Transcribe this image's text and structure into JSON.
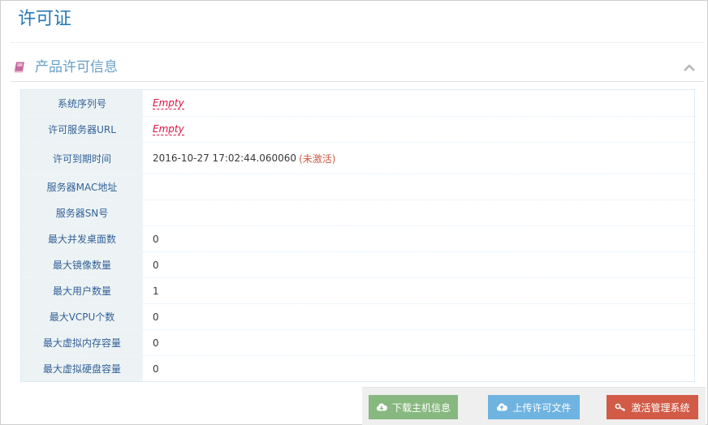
{
  "page": {
    "title": "许可证"
  },
  "section": {
    "title": "产品许可信息",
    "icon": "book-icon",
    "collapse_icon": "chevron-up-icon"
  },
  "rows": [
    {
      "label": "系统序列号",
      "value": "Empty",
      "empty": true
    },
    {
      "label": "许可服务器URL",
      "value": "Empty",
      "empty": true
    },
    {
      "label": "许可到期时间",
      "value": "2016-10-27 17:02:44.060060",
      "status": "(未激活)"
    },
    {
      "label": "服务器MAC地址",
      "value": ""
    },
    {
      "label": "服务器SN号",
      "value": ""
    },
    {
      "label": "最大并发桌面数",
      "value": "0"
    },
    {
      "label": "最大镜像数量",
      "value": "0"
    },
    {
      "label": "最大用户数量",
      "value": "1"
    },
    {
      "label": "最大VCPU个数",
      "value": "0"
    },
    {
      "label": "最大虚拟内存容量",
      "value": "0"
    },
    {
      "label": "最大虚拟硬盘容量",
      "value": "0"
    }
  ],
  "buttons": {
    "download": {
      "label": "下载主机信息",
      "icon": "cloud-download-icon"
    },
    "upload": {
      "label": "上传许可文件",
      "icon": "cloud-upload-icon"
    },
    "activate": {
      "label": "激活管理系统",
      "icon": "key-icon"
    }
  },
  "colors": {
    "title": "#2679b5",
    "section_title": "#669fc7",
    "label_bg": "#edf3f4",
    "label_text": "#336199",
    "empty_text": "#dd1144",
    "status_text": "#d15b47",
    "btn_green": "#87b87f",
    "btn_blue": "#6fb3e0",
    "btn_red": "#d15b47"
  }
}
